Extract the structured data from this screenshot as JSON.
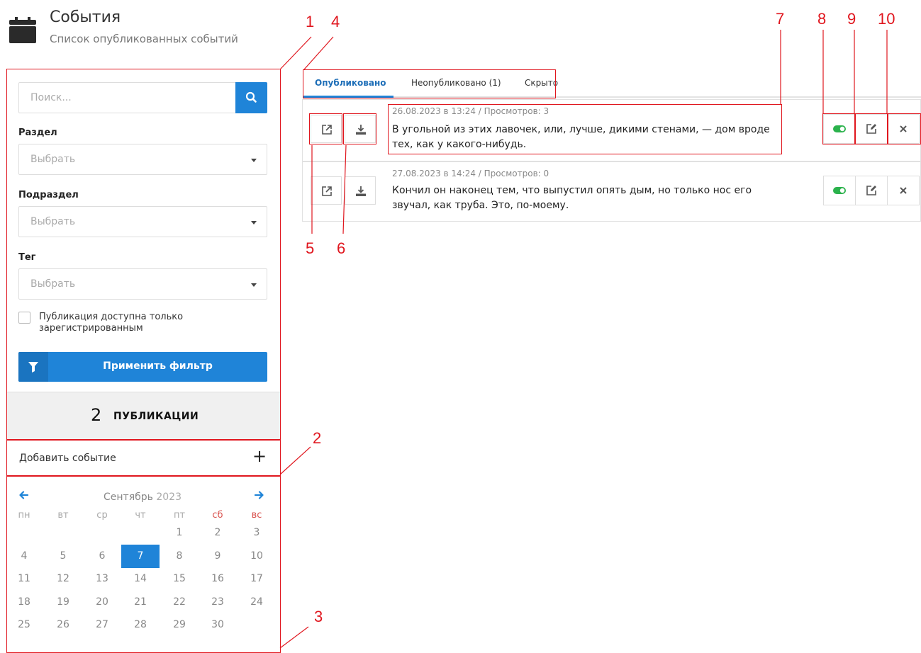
{
  "header": {
    "icon": "calendar-icon",
    "title": "События",
    "subtitle": "Список опубликованных событий"
  },
  "filter": {
    "search_placeholder": "Поиск...",
    "section_label": "Раздел",
    "section_value": "Выбрать",
    "subsection_label": "Подраздел",
    "subsection_value": "Выбрать",
    "tag_label": "Тег",
    "tag_value": "Выбрать",
    "registered_only_label": "Публикация доступна только зарегистрированным",
    "apply_label": "Применить фильтр"
  },
  "count": {
    "number": "2",
    "word": "ПУБЛИКАЦИИ"
  },
  "add_event_label": "Добавить событие",
  "calendar": {
    "month": "Сентябрь",
    "year": "2023",
    "weekdays": [
      "пн",
      "вт",
      "ср",
      "чт",
      "пт",
      "сб",
      "вс"
    ],
    "selected_day": "7",
    "weeks": [
      [
        "",
        "",
        "",
        "",
        "1",
        "2",
        "3"
      ],
      [
        "4",
        "5",
        "6",
        "7",
        "8",
        "9",
        "10"
      ],
      [
        "11",
        "12",
        "13",
        "14",
        "15",
        "16",
        "17"
      ],
      [
        "18",
        "19",
        "20",
        "21",
        "22",
        "23",
        "24"
      ],
      [
        "25",
        "26",
        "27",
        "28",
        "29",
        "30",
        ""
      ]
    ]
  },
  "tabs": [
    {
      "label": "Опубликовано",
      "active": true
    },
    {
      "label": "Неопубликовано (1)",
      "active": false
    },
    {
      "label": "Скрыто",
      "active": false
    }
  ],
  "events": [
    {
      "meta": "26.08.2023 в 13:24 / Просмотров: 3",
      "text": "В угольной из этих лавочек, или, лучше, дикими стенами, — дом вроде тех, как у какого-нибудь."
    },
    {
      "meta": "27.08.2023 в 14:24 / Просмотров: 0",
      "text": "Кончил он наконец тем, что выпустил опять дым, но только нос его звучал, как труба. Это, по-моему."
    }
  ],
  "annotations": [
    "1",
    "2",
    "3",
    "4",
    "5",
    "6",
    "7",
    "8",
    "9",
    "10"
  ],
  "colors": {
    "accent": "#1f84d8",
    "toggle_on": "#2bb24c",
    "annotation": "#e0161e",
    "weekend": "#d9534f"
  }
}
